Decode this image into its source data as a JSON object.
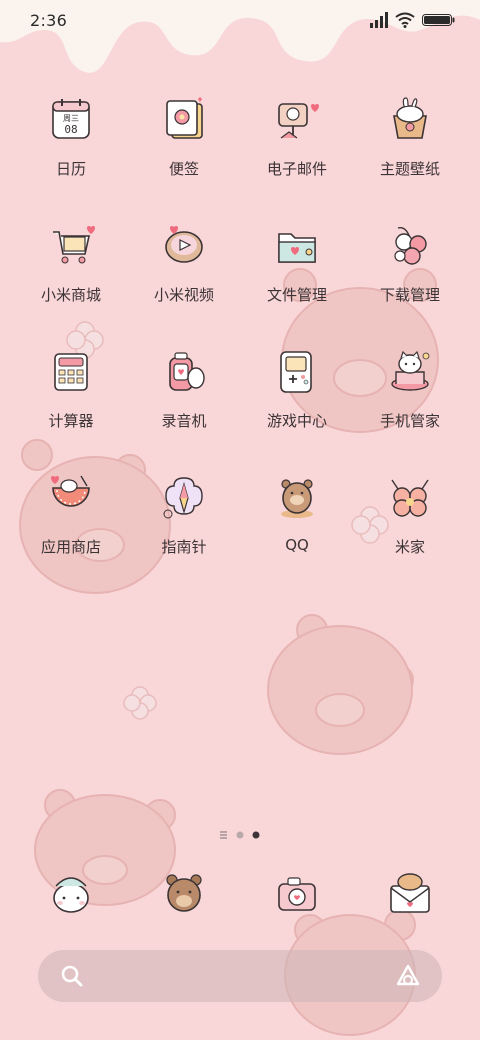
{
  "status_bar": {
    "time": "2:36",
    "battery_percent": 100
  },
  "apps": [
    {
      "label": "日历",
      "icon": "calendar-icon",
      "icon_text": [
        "周三",
        "08"
      ]
    },
    {
      "label": "便签",
      "icon": "notes-icon"
    },
    {
      "label": "电子邮件",
      "icon": "email-icon"
    },
    {
      "label": "主题壁纸",
      "icon": "themes-icon"
    },
    {
      "label": "小米商城",
      "icon": "mi-store-icon"
    },
    {
      "label": "小米视频",
      "icon": "mi-video-icon"
    },
    {
      "label": "文件管理",
      "icon": "file-manager-icon"
    },
    {
      "label": "下载管理",
      "icon": "downloads-icon"
    },
    {
      "label": "计算器",
      "icon": "calculator-icon"
    },
    {
      "label": "录音机",
      "icon": "recorder-icon"
    },
    {
      "label": "游戏中心",
      "icon": "game-center-icon"
    },
    {
      "label": "手机管家",
      "icon": "security-icon"
    },
    {
      "label": "应用商店",
      "icon": "app-store-icon"
    },
    {
      "label": "指南针",
      "icon": "compass-icon"
    },
    {
      "label": "QQ",
      "icon": "qq-icon"
    },
    {
      "label": "米家",
      "icon": "mi-home-icon"
    }
  ],
  "dock": [
    {
      "icon": "phone-icon"
    },
    {
      "icon": "contacts-icon"
    },
    {
      "icon": "camera-icon"
    },
    {
      "icon": "messages-icon"
    }
  ],
  "page_indicator": {
    "pages": 3,
    "current": 3
  },
  "colors": {
    "background": "#f9d6d8",
    "label_text": "#3b3335",
    "search_bar": "#cdb4b8",
    "accent_pink": "#f08a9a"
  }
}
